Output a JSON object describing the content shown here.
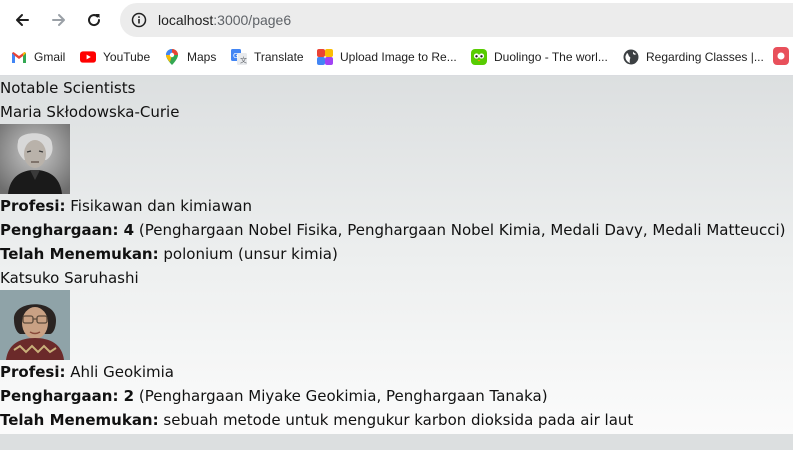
{
  "browser": {
    "url_host": "localhost",
    "url_path": ":3000/page6"
  },
  "bookmarks": [
    {
      "label": "Gmail",
      "icon": "gmail-icon"
    },
    {
      "label": "YouTube",
      "icon": "youtube-icon"
    },
    {
      "label": "Maps",
      "icon": "maps-icon"
    },
    {
      "label": "Translate",
      "icon": "translate-icon"
    },
    {
      "label": "Upload Image to Re...",
      "icon": "upload-icon"
    },
    {
      "label": "Duolingo - The worl...",
      "icon": "duolingo-icon"
    },
    {
      "label": "Regarding Classes |...",
      "icon": "globe-icon"
    }
  ],
  "page": {
    "heading": "Notable Scientists",
    "scientists": [
      {
        "name": "Maria Skłodowska-Curie",
        "profession_label": "Profesi:",
        "profession": "Fisikawan dan kimiawan",
        "awards_label": "Penghargaan: 4",
        "awards": "(Penghargaan Nobel Fisika, Penghargaan Nobel Kimia, Medali Davy, Medali Matteucci)",
        "discovered_label": "Telah Menemukan:",
        "discovered": "polonium (unsur kimia)"
      },
      {
        "name": "Katsuko Saruhashi",
        "profession_label": "Profesi:",
        "profession": "Ahli Geokimia",
        "awards_label": "Penghargaan: 2",
        "awards": "(Penghargaan Miyake Geokimia, Penghargaan Tanaka)",
        "discovered_label": "Telah Menemukan:",
        "discovered": "sebuah metode untuk mengukur karbon dioksida pada air laut"
      }
    ]
  }
}
